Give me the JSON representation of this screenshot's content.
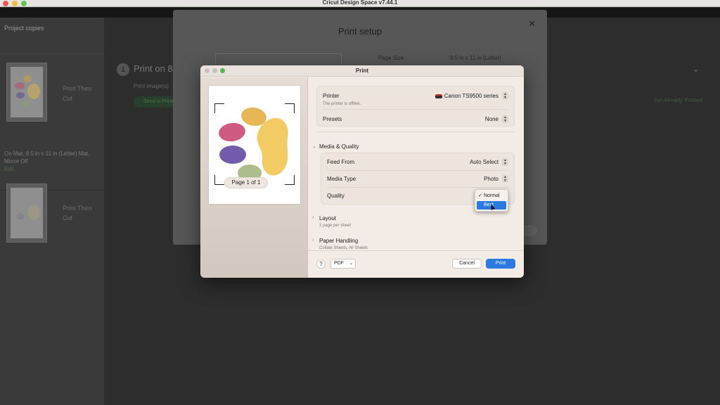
{
  "app": {
    "title": "Cricut Design Space  v7.44.1"
  },
  "sidebar": {
    "header": "Project copies",
    "items": [
      {
        "label_line1": "Print Then",
        "label_line2": "Cut"
      },
      {
        "label_line1": "Print Then",
        "label_line2": "Cut"
      }
    ],
    "caption": "On Mat, 8.5 in x 11 in (Letter) Mat, Mirror Off",
    "caption_link": "Edit"
  },
  "main": {
    "step_number": "1",
    "step_title": "Print on 8",
    "step_subtitle": "Print image(s)",
    "send_button": "Send to Printer",
    "already_printed": "I've Already Printed"
  },
  "print_setup": {
    "title": "Print setup",
    "page_size_label": "Page Size",
    "page_size_value": "8.5 in x 11 in (Letter)"
  },
  "print_dialog": {
    "title": "Print",
    "preview": {
      "page_label": "Page 1 of 1"
    },
    "printer": {
      "label": "Printer",
      "value": "Canon TS9500 series",
      "status": "The printer is offline."
    },
    "presets": {
      "label": "Presets",
      "value": "None"
    },
    "media_quality": {
      "heading": "Media & Quality",
      "feed_from": {
        "label": "Feed From",
        "value": "Auto Select"
      },
      "media_type": {
        "label": "Media Type",
        "value": "Photo"
      },
      "quality": {
        "label": "Quality"
      }
    },
    "quality_menu": {
      "options": [
        "Normal",
        "Best"
      ],
      "checked": "Normal",
      "highlighted": "Best"
    },
    "layout": {
      "heading": "Layout",
      "sub": "1 page per sheet"
    },
    "paper_handling": {
      "heading": "Paper Handling",
      "sub": "Collate Sheets, All Sheets"
    },
    "footer": {
      "help": "?",
      "pdf": "PDF",
      "cancel": "Cancel",
      "print": "Print"
    }
  },
  "colors": {
    "accent": "#2a7ae2",
    "dialog_bg": "#f3ebe5",
    "app_green": "#27402c"
  },
  "icons": {
    "close": "close-icon",
    "chevron": "chevron-down-icon",
    "printer": "printer-icon",
    "check": "checkmark-icon",
    "cursor": "mouse-pointer-icon"
  }
}
